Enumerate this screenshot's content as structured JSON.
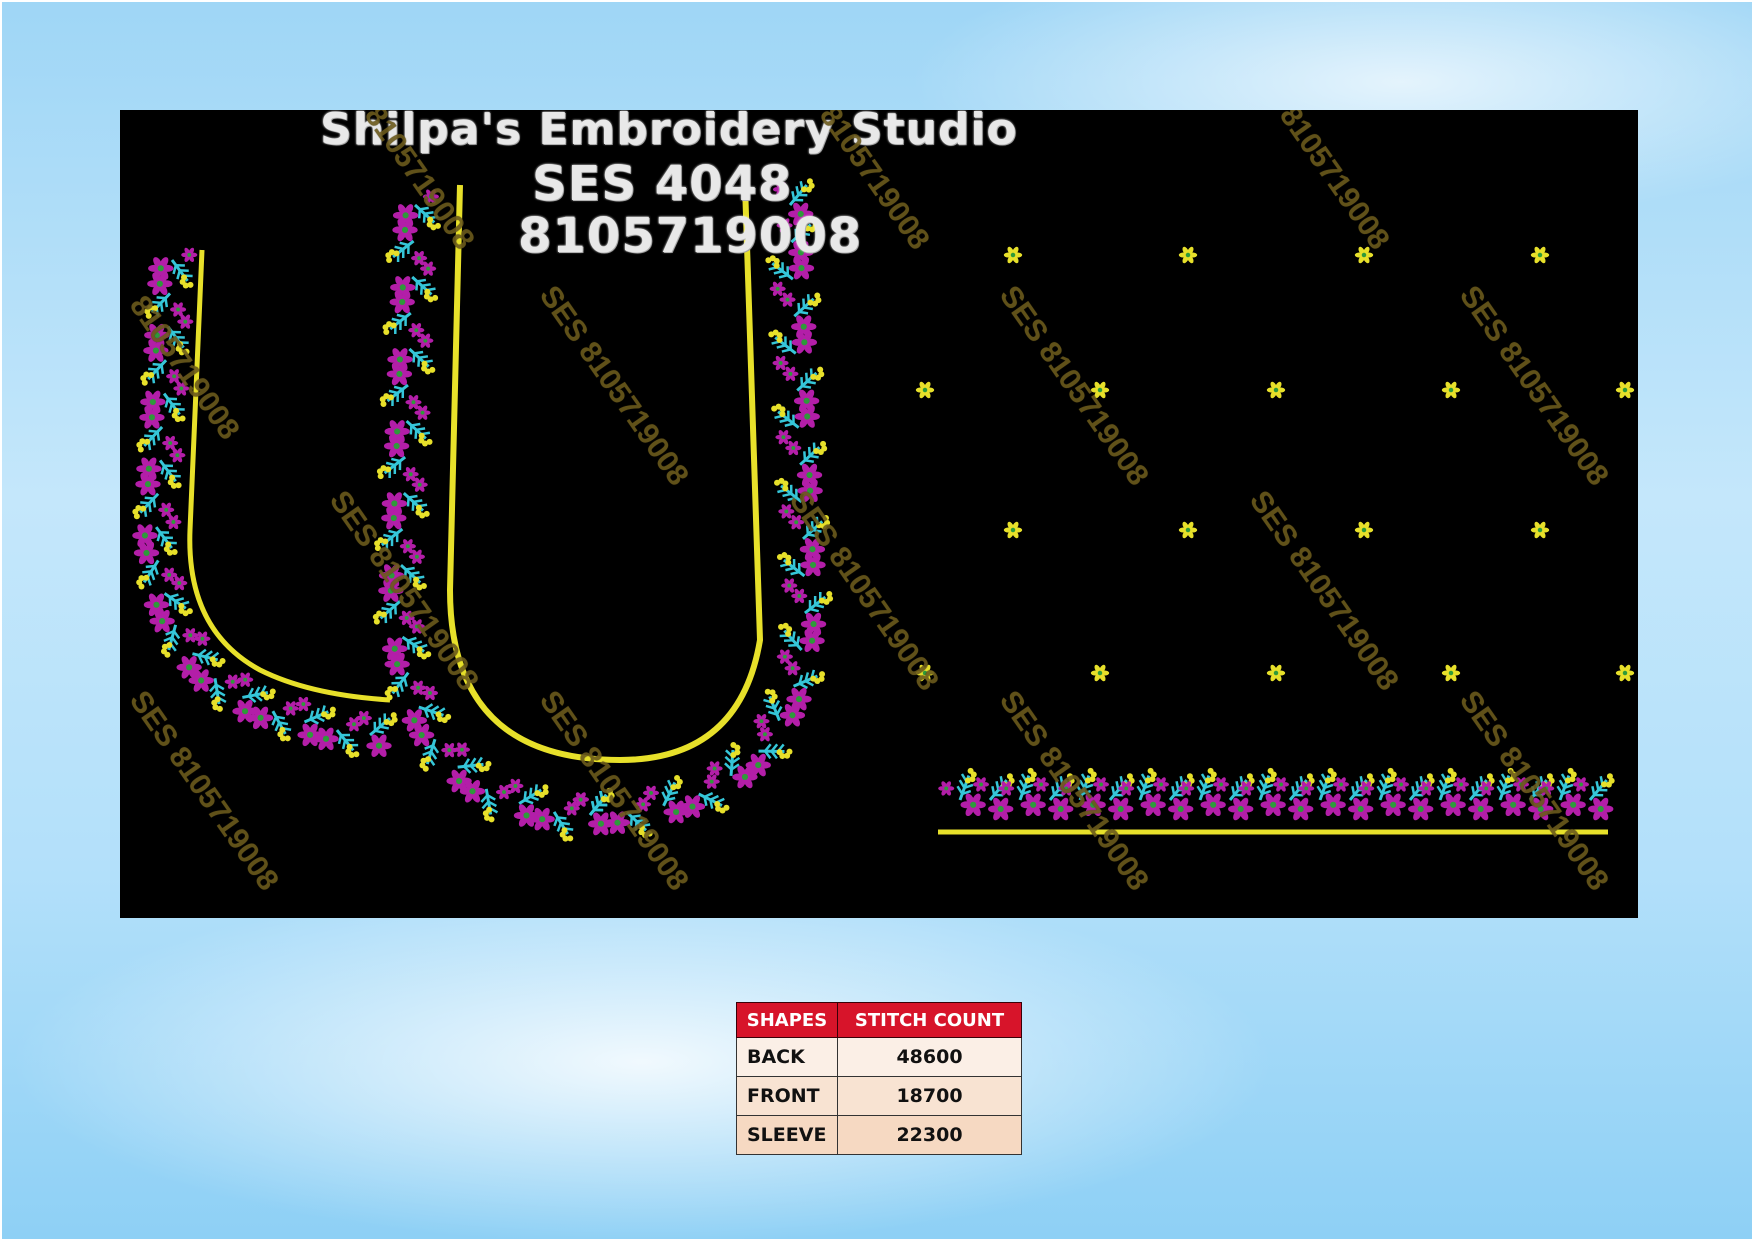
{
  "title": {
    "studio": "Shilpa's Embroidery Studio",
    "code": "SES 4048",
    "phone": "8105719008"
  },
  "watermark": {
    "short": "8105719008",
    "long": "SES 8105719008"
  },
  "colors": {
    "gold": "#e7e02a",
    "magenta": "#b31ea8",
    "cyan": "#35c6d8",
    "green": "#2e9a3a",
    "table_header": "#d7142a"
  },
  "stitch_table": {
    "headers": [
      "SHAPES",
      "STITCH COUNT"
    ],
    "rows": [
      {
        "shape": "BACK",
        "count": "48600"
      },
      {
        "shape": "FRONT",
        "count": "18700"
      },
      {
        "shape": "SLEEVE",
        "count": "22300"
      }
    ]
  }
}
